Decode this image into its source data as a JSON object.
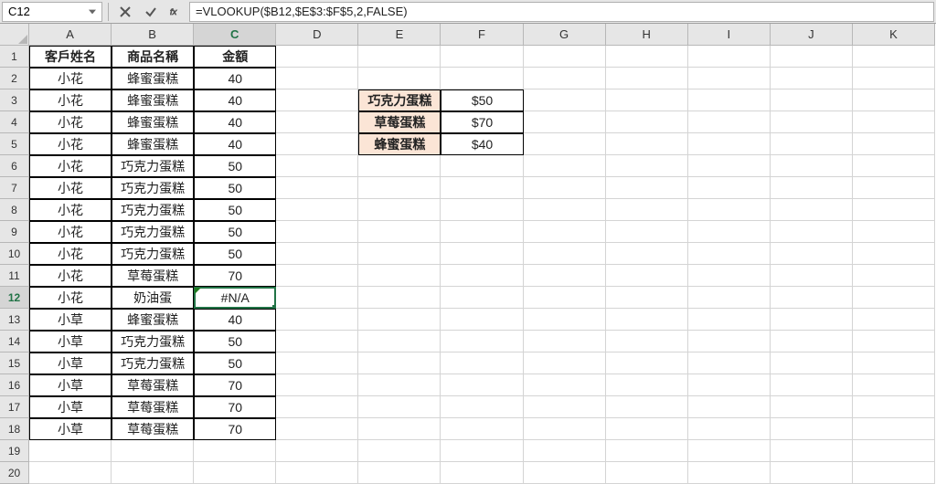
{
  "formula_bar": {
    "active_cell": "C12",
    "formula": "=VLOOKUP($B12,$E$3:$F$5,2,FALSE)"
  },
  "columns": [
    "A",
    "B",
    "C",
    "D",
    "E",
    "F",
    "G",
    "H",
    "I",
    "J",
    "K"
  ],
  "active_column_index": 2,
  "active_row_index": 12,
  "row_count": 20,
  "headers": {
    "A": "客戶姓名",
    "B": "商品名稱",
    "C": "金額"
  },
  "rows": [
    {
      "a": "小花",
      "b": "蜂蜜蛋糕",
      "c": "40"
    },
    {
      "a": "小花",
      "b": "蜂蜜蛋糕",
      "c": "40"
    },
    {
      "a": "小花",
      "b": "蜂蜜蛋糕",
      "c": "40"
    },
    {
      "a": "小花",
      "b": "蜂蜜蛋糕",
      "c": "40"
    },
    {
      "a": "小花",
      "b": "巧克力蛋糕",
      "c": "50"
    },
    {
      "a": "小花",
      "b": "巧克力蛋糕",
      "c": "50"
    },
    {
      "a": "小花",
      "b": "巧克力蛋糕",
      "c": "50"
    },
    {
      "a": "小花",
      "b": "巧克力蛋糕",
      "c": "50"
    },
    {
      "a": "小花",
      "b": "巧克力蛋糕",
      "c": "50"
    },
    {
      "a": "小花",
      "b": "草莓蛋糕",
      "c": "70"
    },
    {
      "a": "小花",
      "b": "奶油蛋",
      "c": "#N/A",
      "error": true,
      "smarttag": "!"
    },
    {
      "a": "小草",
      "b": "蜂蜜蛋糕",
      "c": "40"
    },
    {
      "a": "小草",
      "b": "巧克力蛋糕",
      "c": "50"
    },
    {
      "a": "小草",
      "b": "巧克力蛋糕",
      "c": "50"
    },
    {
      "a": "小草",
      "b": "草莓蛋糕",
      "c": "70"
    },
    {
      "a": "小草",
      "b": "草莓蛋糕",
      "c": "70"
    },
    {
      "a": "小草",
      "b": "草莓蛋糕",
      "c": "70"
    }
  ],
  "lookup": [
    {
      "label": "巧克力蛋糕",
      "val": "$50"
    },
    {
      "label": "草莓蛋糕",
      "val": "$70"
    },
    {
      "label": "蜂蜜蛋糕",
      "val": "$40"
    }
  ]
}
